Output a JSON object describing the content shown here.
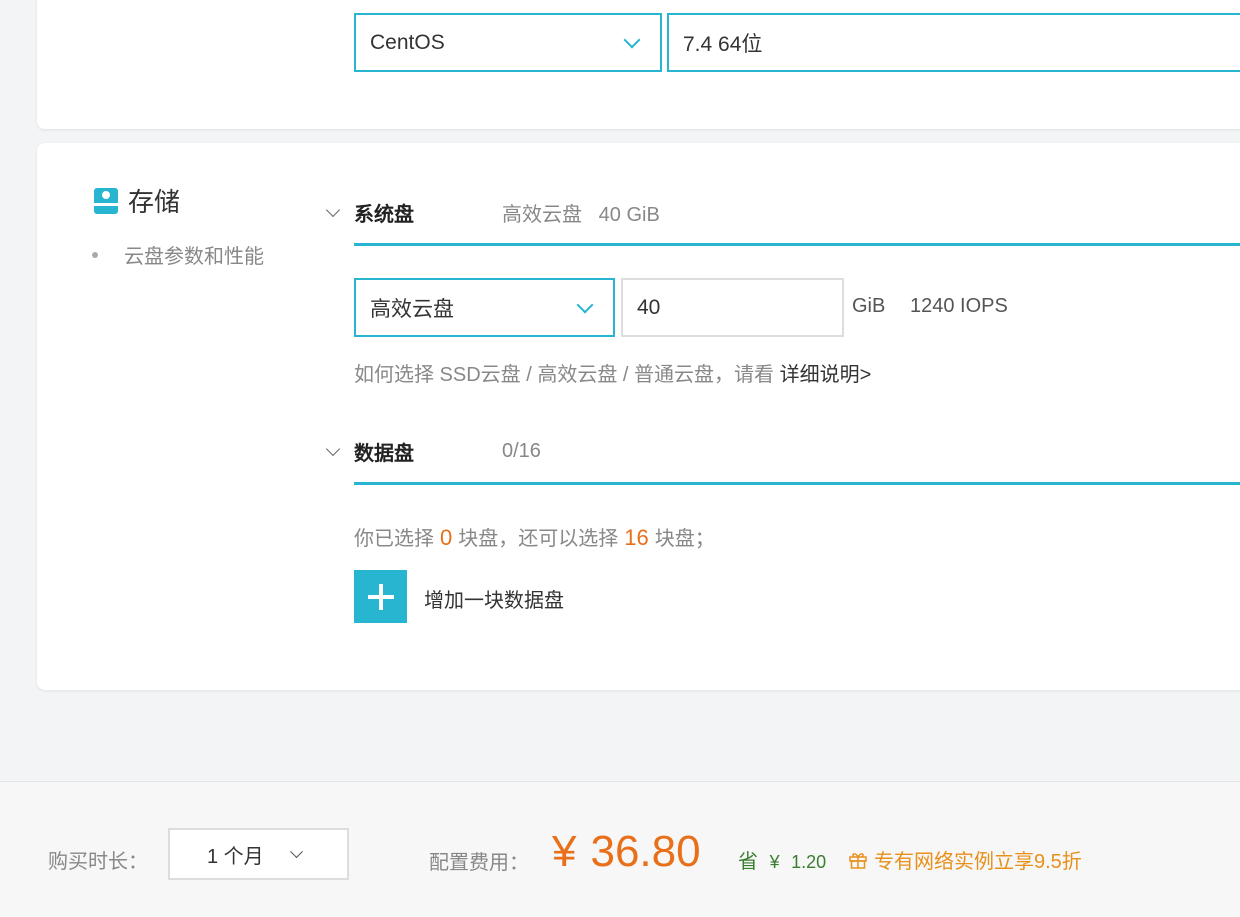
{
  "os": {
    "type": "CentOS",
    "version": "7.4 64位"
  },
  "storage": {
    "title": "存储",
    "subtitle": "云盘参数和性能",
    "system_disk": {
      "label": "系统盘",
      "summary": "高效云盘   40 GiB",
      "type": "高效云盘",
      "size": "40",
      "unit": "GiB",
      "iops": "1240 IOPS",
      "help_text": "如何选择 SSD云盘 / 高效云盘 / 普通云盘，请看 ",
      "help_link": "详细说明>"
    },
    "data_disk": {
      "label": "数据盘",
      "summary": "0/16",
      "count_prefix": "你已选择",
      "selected": "0",
      "count_mid": "块盘，还可以选择",
      "remaining": "16",
      "count_suffix": "块盘；",
      "add_label": "增加一块数据盘"
    }
  },
  "footer": {
    "duration_label": "购买时长：",
    "duration_value": "1 个月",
    "cost_label": "配置费用：",
    "currency": "¥",
    "price": "36.80",
    "save_label": "省",
    "save_currency": "¥",
    "save_amount": "1.20",
    "promo": "专有网络实例立享9.5折"
  },
  "colors": {
    "accent": "#27b5d0",
    "price": "#e8701a",
    "save": "#3a7d2e",
    "promo": "#e8901a"
  }
}
